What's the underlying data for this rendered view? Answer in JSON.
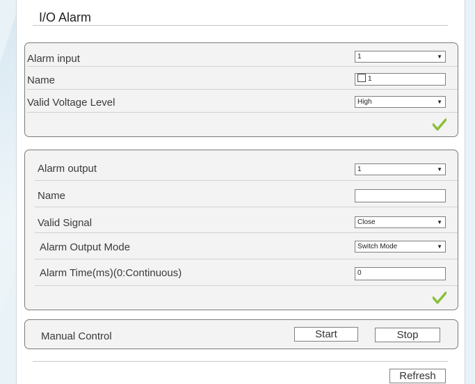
{
  "page": {
    "title": "I/O Alarm"
  },
  "alarm_input": {
    "rows": [
      {
        "label": "Alarm input",
        "value": "1"
      },
      {
        "label": "Name",
        "value": "1"
      },
      {
        "label": "Valid Voltage Level",
        "value": "High"
      }
    ]
  },
  "alarm_output": {
    "rows": [
      {
        "label": "Alarm output",
        "value": "1"
      },
      {
        "label": "Name",
        "value": ""
      },
      {
        "label": "Valid Signal",
        "value": "Close"
      },
      {
        "label": "Alarm Output Mode",
        "value": "Switch Mode"
      },
      {
        "label": "Alarm Time(ms)(0:Continuous)",
        "value": "0"
      }
    ]
  },
  "manual": {
    "label": "Manual Control",
    "start": "Start",
    "stop": "Stop"
  },
  "footer": {
    "refresh": "Refresh"
  },
  "colors": {
    "check": "#8bbf3c",
    "border": "#7a7a7a"
  },
  "icons": {
    "apply": "checkmark-icon",
    "dropdown": "triangle-down"
  }
}
